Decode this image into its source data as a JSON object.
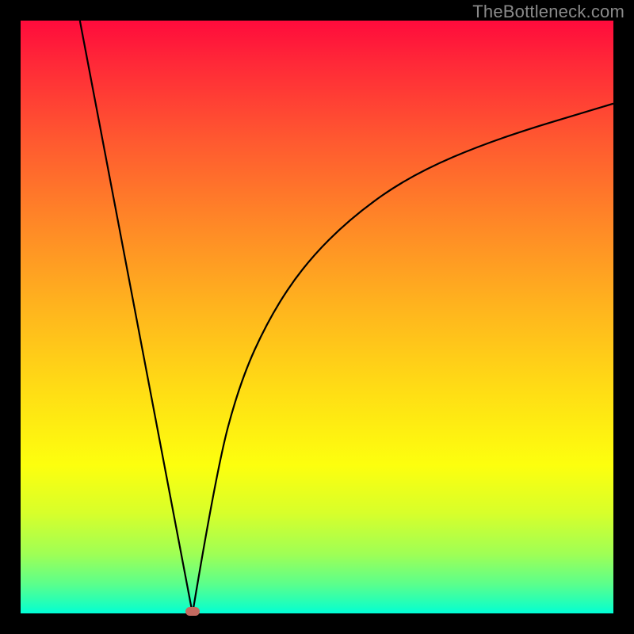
{
  "watermark": "TheBottleneck.com",
  "chart_data": {
    "type": "line",
    "title": "",
    "xlabel": "",
    "ylabel": "",
    "xlim": [
      0,
      100
    ],
    "ylim": [
      0,
      100
    ],
    "grid": false,
    "legend": false,
    "background": "rainbow-gradient-red-to-green",
    "curve": {
      "description": "V-shaped bottleneck curve with vertex near x≈29, y≈0; left branch nearly straight to top-left corner; right branch convex rising toward upper right",
      "vertex": {
        "x": 29,
        "y": 0
      },
      "left_branch": [
        {
          "x": 10,
          "y": 100
        },
        {
          "x": 29,
          "y": 0
        }
      ],
      "right_branch_samples": [
        {
          "x": 29,
          "y": 0
        },
        {
          "x": 33,
          "y": 24
        },
        {
          "x": 37,
          "y": 39
        },
        {
          "x": 42,
          "y": 50
        },
        {
          "x": 48,
          "y": 59
        },
        {
          "x": 56,
          "y": 67
        },
        {
          "x": 66,
          "y": 74
        },
        {
          "x": 80,
          "y": 80
        },
        {
          "x": 100,
          "y": 86
        }
      ]
    },
    "marker": {
      "x": 29,
      "y": 0,
      "color": "#c46a60"
    }
  }
}
